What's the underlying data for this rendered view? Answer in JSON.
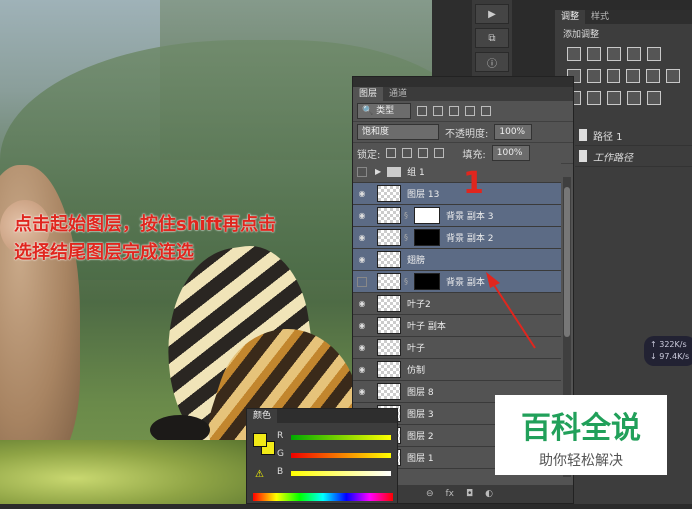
{
  "annotation": {
    "line1": "点击起始图层，按住shift再点击",
    "line2": "选择结尾图层完成连选",
    "step_number": "1"
  },
  "adjust_panel": {
    "tabs": [
      "调整",
      "样式"
    ],
    "title": "添加调整"
  },
  "paths_panel": {
    "items": [
      "路径 1",
      "工作路径"
    ]
  },
  "network_speed": {
    "up": "322K/s",
    "down": "97.4K/s"
  },
  "layers_panel": {
    "tabs": [
      "图层",
      "通道"
    ],
    "filter_type": "类型",
    "blend_mode": "饱和度",
    "opacity_label": "不透明度:",
    "opacity_value": "100%",
    "lock_label": "锁定:",
    "fill_label": "填充:",
    "fill_value": "100%",
    "layers": [
      {
        "name": "组 1",
        "kind": "group",
        "selected": false,
        "visible": false
      },
      {
        "name": "图层 13",
        "kind": "plain",
        "selected": true,
        "visible": true
      },
      {
        "name": "背景 副本 3",
        "kind": "masked-white",
        "selected": true,
        "visible": true
      },
      {
        "name": "背景 副本 2",
        "kind": "masked",
        "selected": true,
        "visible": true
      },
      {
        "name": "翅膀",
        "kind": "plain",
        "selected": true,
        "visible": true
      },
      {
        "name": "背景 副本",
        "kind": "masked",
        "selected": true,
        "visible": false
      },
      {
        "name": "叶子2",
        "kind": "plain",
        "selected": false,
        "visible": true
      },
      {
        "name": "叶子 副本",
        "kind": "plain",
        "selected": false,
        "visible": true
      },
      {
        "name": "叶子",
        "kind": "plain",
        "selected": false,
        "visible": true
      },
      {
        "name": "仿制",
        "kind": "plain",
        "selected": false,
        "visible": true
      },
      {
        "name": "图层 8",
        "kind": "plain",
        "selected": false,
        "visible": true
      },
      {
        "name": "图层 3",
        "kind": "plain",
        "selected": false,
        "visible": true
      },
      {
        "name": "图层 2",
        "kind": "plain",
        "selected": false,
        "visible": true
      },
      {
        "name": "图层 1",
        "kind": "plain",
        "selected": false,
        "visible": true
      }
    ]
  },
  "color_panel": {
    "tab": "颜色",
    "channels": [
      "R",
      "G",
      "B"
    ],
    "fg_color": "#f2ea17"
  },
  "watermark": {
    "title": "百科全说",
    "subtitle": "助你轻松解决"
  }
}
